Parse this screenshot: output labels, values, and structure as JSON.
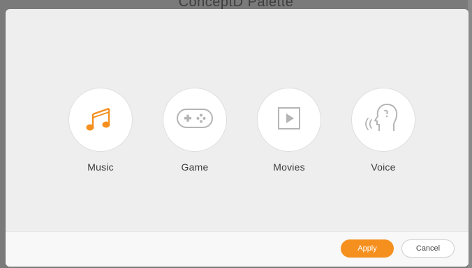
{
  "window": {
    "title": "ConceptD Palette"
  },
  "dialog": {
    "options": [
      {
        "label": "Music",
        "icon": "music-note-icon",
        "selected": true
      },
      {
        "label": "Game",
        "icon": "gamepad-icon",
        "selected": false
      },
      {
        "label": "Movies",
        "icon": "play-icon",
        "selected": false
      },
      {
        "label": "Voice",
        "icon": "voice-head-icon",
        "selected": false
      }
    ],
    "footer": {
      "apply_label": "Apply",
      "cancel_label": "Cancel"
    }
  },
  "colors": {
    "accent": "#f5901f",
    "icon_inactive": "#b5b5b5",
    "dialog_bg": "#eeeeee",
    "footer_bg": "#f8f8f8"
  }
}
